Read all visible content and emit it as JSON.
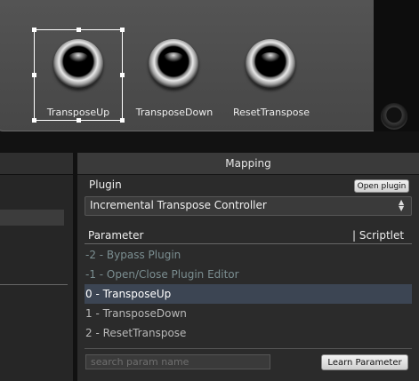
{
  "controls": [
    {
      "label": "TransposeUp"
    },
    {
      "label": "TransposeDown"
    },
    {
      "label": "ResetTranspose"
    }
  ],
  "mapping": {
    "title": "Mapping",
    "plugin_label": "Plugin",
    "open_plugin_button": "Open plugin",
    "plugin_selected": "Incremental Transpose Controller",
    "columns": {
      "parameter": "Parameter",
      "scriptlet": "| Scriptlet"
    },
    "rows": [
      {
        "label": "-2 - Bypass Plugin"
      },
      {
        "label": "-1 - Open/Close Plugin Editor"
      },
      {
        "label": "0 - TransposeUp"
      },
      {
        "label": "1 - TransposeDown"
      },
      {
        "label": "2 - ResetTranspose"
      }
    ],
    "search_placeholder": "search param name",
    "learn_button": "Learn Parameter"
  },
  "icons": {
    "select_arrows": "up-down-arrows-icon"
  }
}
